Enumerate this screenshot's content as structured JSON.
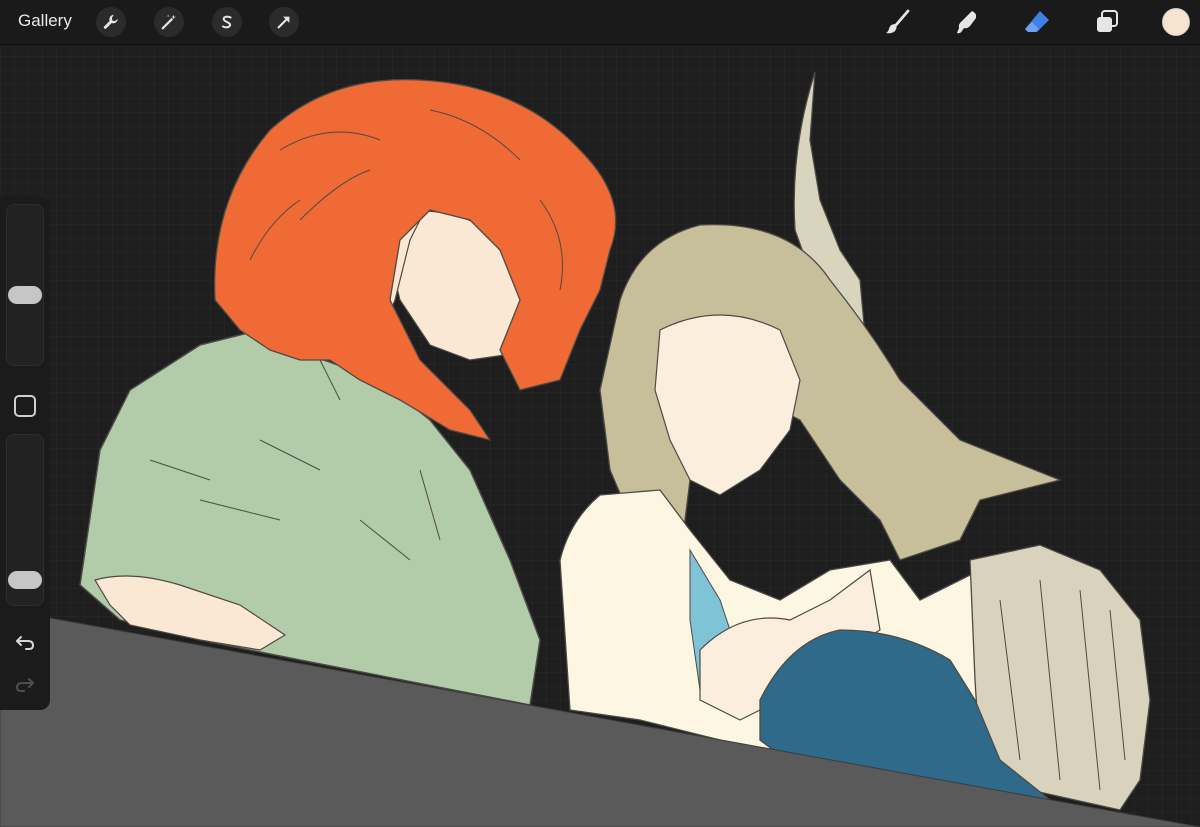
{
  "toolbar": {
    "gallery_label": "Gallery",
    "left_tools": [
      "wrench-icon",
      "magic-wand-icon",
      "selection-s-icon",
      "transform-arrow-icon"
    ],
    "right_tools": [
      "brush-icon",
      "smudge-icon",
      "eraser-icon",
      "layers-icon"
    ],
    "active_tool": "eraser",
    "current_color": "#f7e3cf",
    "eraser_color": "#3f7fe8"
  },
  "sidebar": {
    "brush_size_level": 0.43,
    "opacity_level": 0.1,
    "modify_button_icon": "square-icon",
    "undo_icon": "undo-icon",
    "redo_icon": "redo-icon"
  },
  "canvas": {
    "background_color": "#1e1e1e",
    "content": "illustration-two-characters"
  }
}
